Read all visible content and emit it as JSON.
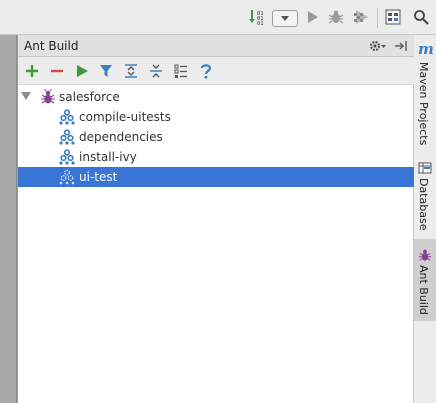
{
  "toolbar": {
    "icons": [
      "sort-numeric-icon",
      "run-config-dropdown",
      "run-icon",
      "debug-icon",
      "coverage-icon",
      "project-structure-icon",
      "search-icon"
    ]
  },
  "tool_window": {
    "title": "Ant Build",
    "actions": [
      {
        "name": "add-icon",
        "color": "#3c9a3c"
      },
      {
        "name": "remove-icon",
        "color": "#d24a4a"
      },
      {
        "name": "run-icon",
        "color": "#3c9a3c"
      },
      {
        "name": "filter-icon",
        "color": "#3d7fc1"
      },
      {
        "name": "expand-all-icon",
        "color": "#3d7fc1"
      },
      {
        "name": "collapse-all-icon",
        "color": "#3d7fc1"
      },
      {
        "name": "properties-icon",
        "color": "#555555"
      },
      {
        "name": "help-icon",
        "color": "#3d7fc1"
      }
    ]
  },
  "tree": {
    "root": {
      "label": "salesforce",
      "icon": "ant-bug-icon",
      "expanded": true
    },
    "targets": [
      {
        "label": "compile-uitests",
        "selected": false
      },
      {
        "label": "dependencies",
        "selected": false
      },
      {
        "label": "install-ivy",
        "selected": false
      },
      {
        "label": "ui-test",
        "selected": true
      }
    ]
  },
  "right_stripe": {
    "maven_icon_text": "m",
    "buttons": [
      {
        "label": "Maven Projects",
        "active": false
      },
      {
        "label": "Database",
        "active": false
      },
      {
        "label": "Ant Build",
        "active": true
      }
    ]
  },
  "colors": {
    "selection": "#3875d7",
    "accent": "#3d7fc1",
    "ant": "#8a3f9a"
  }
}
